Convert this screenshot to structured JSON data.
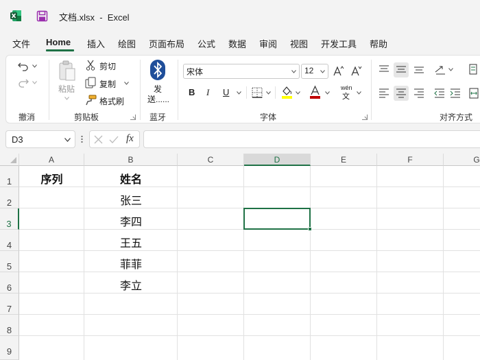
{
  "title_bar": {
    "file_title": "文档.xlsx  -  Excel"
  },
  "menu_tabs": [
    "文件",
    "Home",
    "插入",
    "绘图",
    "页面布局",
    "公式",
    "数据",
    "审阅",
    "视图",
    "开发工具",
    "帮助"
  ],
  "ribbon": {
    "groups": {
      "undo": "撤消",
      "clipboard": "剪贴板",
      "bluetooth": "蓝牙",
      "font": "字体",
      "alignment": "对齐方式"
    },
    "clipboard": {
      "paste": "粘贴",
      "cut": "剪切",
      "copy": "复制",
      "format_painter": "格式刷"
    },
    "bluetooth": {
      "send_line1": "发",
      "send_line2": "送......"
    },
    "font": {
      "name": "宋体",
      "size": "12",
      "bold": "B",
      "italic": "I",
      "underline": "U",
      "wen": "wén",
      "wen2": "文"
    }
  },
  "formula_bar": {
    "name_box": "D3",
    "fx": "fx",
    "formula": ""
  },
  "sheet": {
    "columns": [
      "A",
      "B",
      "C",
      "D",
      "E",
      "F",
      "G"
    ],
    "rows": [
      "1",
      "2",
      "3",
      "4",
      "5",
      "6",
      "7",
      "8",
      "9"
    ],
    "active_cell": "D3",
    "cells": {
      "A1": "序列",
      "B1": "姓名",
      "B2": "张三",
      "B3": "李四",
      "B4": "王五",
      "B5": "菲菲",
      "B6": "李立"
    }
  },
  "colors": {
    "accent": "#1e7145",
    "excel_green": "#107c41",
    "save_purple": "#9b2fae",
    "font_red": "#c00000",
    "highlight_yellow": "#ffff00"
  }
}
